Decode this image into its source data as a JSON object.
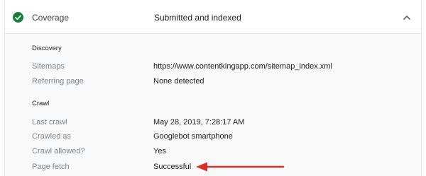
{
  "header": {
    "title": "Coverage",
    "value": "Submitted and indexed",
    "status_icon": "check-circle-icon",
    "toggle_icon": "chevron-up-icon"
  },
  "discovery": {
    "title": "Discovery",
    "rows": [
      {
        "label": "Sitemaps",
        "value": "https://www.contentkingapp.com/sitemap_index.xml"
      },
      {
        "label": "Referring page",
        "value": "None detected"
      }
    ]
  },
  "crawl": {
    "title": "Crawl",
    "rows": [
      {
        "label": "Last crawl",
        "value": "May 28, 2019, 7:28:17 AM"
      },
      {
        "label": "Crawled as",
        "value": "Googlebot smartphone"
      },
      {
        "label": "Crawl allowed?",
        "value": "Yes"
      },
      {
        "label": "Page fetch",
        "value": "Successful"
      }
    ]
  },
  "colors": {
    "success": "#188038",
    "annotation_arrow": "#d93025"
  }
}
